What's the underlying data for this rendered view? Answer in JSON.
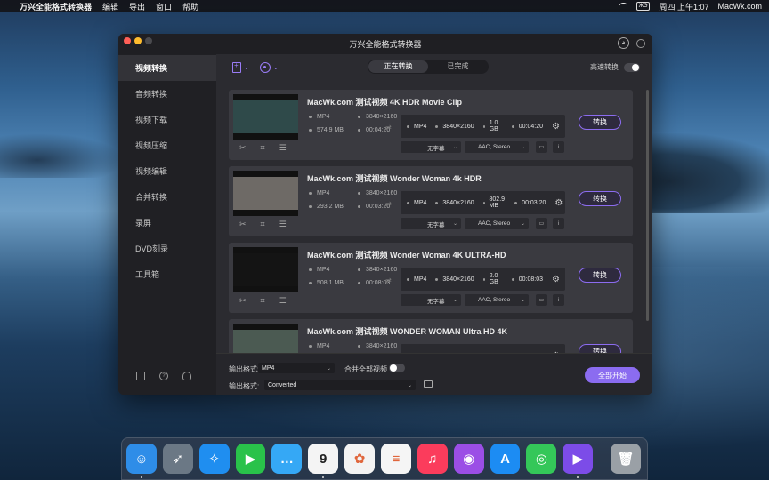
{
  "menubar": {
    "app_name": "万兴全能格式转换器",
    "items": [
      "编辑",
      "导出",
      "窗口",
      "帮助"
    ],
    "input_badge": "ЖЭ",
    "clock": "周四 上午1:07",
    "site": "MacWk.com"
  },
  "window": {
    "title": "万兴全能格式转换器"
  },
  "sidebar": {
    "items": [
      {
        "label": "视频转换",
        "active": true
      },
      {
        "label": "音频转换"
      },
      {
        "label": "视频下载"
      },
      {
        "label": "视频压缩"
      },
      {
        "label": "视频编辑"
      },
      {
        "label": "合并转换"
      },
      {
        "label": "录屏"
      },
      {
        "label": "DVD刻录"
      },
      {
        "label": "工具箱"
      }
    ],
    "bottom_icons": [
      "book-icon",
      "help-icon",
      "account-icon"
    ]
  },
  "toolbar": {
    "tabs": [
      "正在转换",
      "已完成"
    ],
    "active_tab": "正在转换",
    "speed_label": "高速转换",
    "speed_on": false
  },
  "files": [
    {
      "title": "MacWk.com 测试视频 4K HDR Movie Clip",
      "format": "MP4",
      "resolution": "3840×2160",
      "size": "574.9 MB",
      "duration": "00:04:20",
      "out_format": "MP4",
      "out_resolution": "3840×2160",
      "out_size": "1.0 GB",
      "out_duration": "00:04:20",
      "subtitle": "无字幕",
      "audio": "AAC, Stereo",
      "button": "转换",
      "thumb_color": "#2f4a4a"
    },
    {
      "title": "MacWk.com 测试视频 Wonder Woman 4k HDR",
      "format": "MP4",
      "resolution": "3840×2160",
      "size": "293.2 MB",
      "duration": "00:03:20",
      "out_format": "MP4",
      "out_resolution": "3840×2160",
      "out_size": "802.9 MB",
      "out_duration": "00:03:20",
      "subtitle": "无字幕",
      "audio": "AAC, Stereo",
      "button": "转换",
      "thumb_color": "#6e6a66"
    },
    {
      "title": "MacWk.com 测试视频 Wonder Woman 4K ULTRA-HD",
      "format": "MP4",
      "resolution": "3840×2160",
      "size": "508.1 MB",
      "duration": "00:08:03",
      "out_format": "MP4",
      "out_resolution": "3840×2160",
      "out_size": "2.0 GB",
      "out_duration": "00:08:03",
      "subtitle": "无字幕",
      "audio": "AAC, Stereo",
      "button": "转换",
      "thumb_color": "#141414"
    },
    {
      "title": "MacWk.com 测试视频 WONDER WOMAN Ultra HD 4K",
      "format": "MP4",
      "resolution": "3840×2160",
      "size": "",
      "duration": "",
      "out_format": "",
      "out_resolution": "",
      "out_size": "",
      "out_duration": "",
      "subtitle": "",
      "audio": "",
      "button": "转换",
      "thumb_color": "#4b5a52"
    }
  ],
  "bottom": {
    "output_format_label": "输出格式:",
    "output_format_value": "MP4",
    "merge_label": "合并全部视频",
    "merge_on": false,
    "output_dir_label": "输出格式:",
    "output_dir_value": "Converted",
    "start_all": "全部开始"
  },
  "dock": {
    "apps": [
      {
        "name": "finder-icon",
        "color": "#2e8de8"
      },
      {
        "name": "launchpad-icon",
        "color": "#6b7885"
      },
      {
        "name": "safari-icon",
        "color": "#1f8ef0"
      },
      {
        "name": "facetime-icon",
        "color": "#29c24a"
      },
      {
        "name": "messages-icon",
        "color": "#35a8f5"
      },
      {
        "name": "calendar-icon",
        "color": "#f4f4f4",
        "text": "9"
      },
      {
        "name": "photos-icon",
        "color": "#f3f3f3"
      },
      {
        "name": "reminders-icon",
        "color": "#f5f5f5"
      },
      {
        "name": "music-icon",
        "color": "#fb3c5c"
      },
      {
        "name": "podcasts-icon",
        "color": "#9b4ee6"
      },
      {
        "name": "app-store-icon",
        "color": "#1c8cf3"
      },
      {
        "name": "find-my-icon",
        "color": "#34c759"
      },
      {
        "name": "uniconverter-icon",
        "color": "#7c4ce8"
      },
      {
        "name": "trash-icon",
        "color": "#9aa0a6"
      }
    ]
  }
}
